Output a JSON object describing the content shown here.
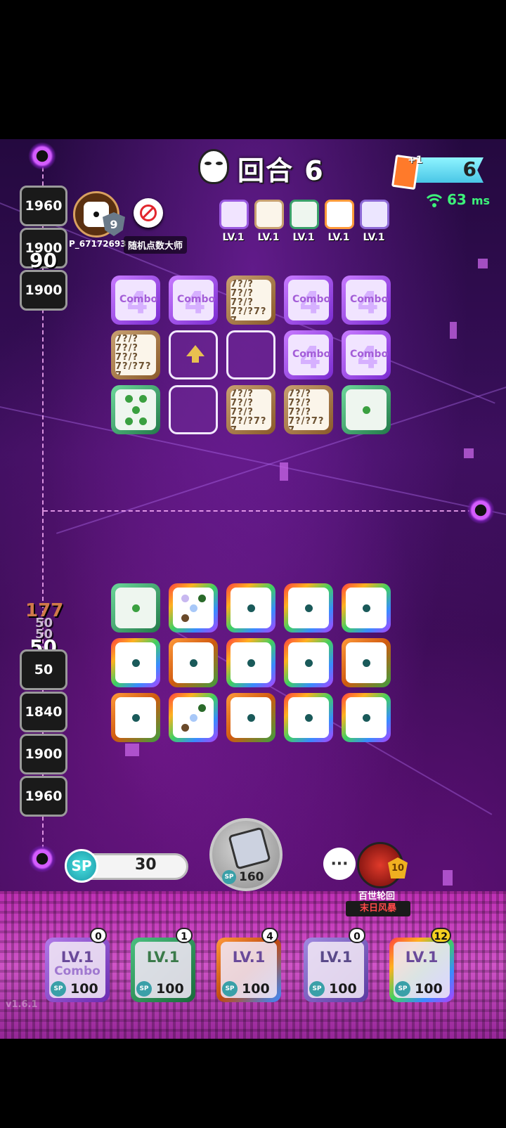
{
  "hud": {
    "round_label": "回合 6",
    "card_plus": "+1",
    "card_count": "6",
    "ping_value": "63",
    "ping_unit": "ms"
  },
  "opponent": {
    "rank": "9",
    "player_id": "P_67172693",
    "title": "随机点数大师",
    "deck": [
      {
        "name": "Combo",
        "level": "LV.1"
      },
      {
        "name": "question",
        "level": "LV.1"
      },
      {
        "name": "pentagram",
        "level": "LV.1"
      },
      {
        "name": "infinity",
        "level": "LV.1"
      },
      {
        "name": "moon",
        "level": "LV.1"
      }
    ],
    "scores": [
      "1960",
      "1900",
      "1900"
    ],
    "float_score": "90"
  },
  "player": {
    "scores": [
      "50",
      "1840",
      "1900",
      "1960"
    ],
    "float_scores": [
      "177",
      "50",
      "50",
      "50"
    ],
    "sp_value": "30",
    "roll_cost": "160",
    "sp_icon_label": "SP",
    "deck": [
      {
        "level": "LV.1",
        "sub": "Combo",
        "cost": "100",
        "count": "0"
      },
      {
        "level": "LV.1",
        "sub": "",
        "cost": "100",
        "count": "1"
      },
      {
        "level": "LV.1",
        "sub": "",
        "cost": "100",
        "count": "4"
      },
      {
        "level": "LV.1",
        "sub": "",
        "cost": "100",
        "count": "0"
      },
      {
        "level": "LV.1",
        "sub": "",
        "cost": "100",
        "count": "12"
      }
    ]
  },
  "boss": {
    "name": "百世轮回",
    "mode": "末日风暴",
    "badge": "10"
  },
  "chat_label": "···",
  "version": "v1.6.1",
  "tiles": {
    "combo_big": "4",
    "combo_word": "Combo",
    "question_text": "7?/?7?/?7?/?7?/?7?7"
  },
  "colors": {
    "accent": "#d45cff",
    "ping": "#3df27a",
    "sp": "#3aa0a8",
    "boss_mode": "#ff4a4a"
  }
}
